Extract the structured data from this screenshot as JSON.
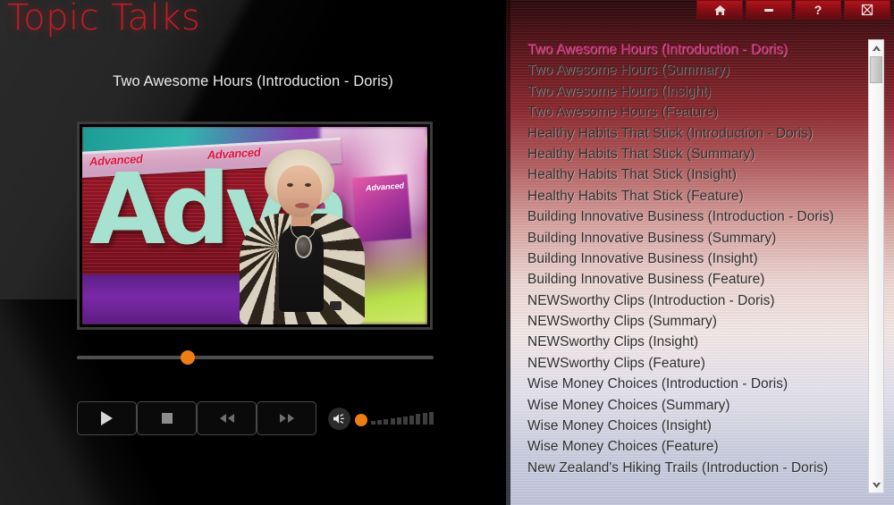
{
  "app": {
    "title": "Topic Talks"
  },
  "window_controls": [
    {
      "name": "home",
      "icon": "home-icon",
      "label": ""
    },
    {
      "name": "minimize",
      "icon": "minimize-icon",
      "label": ""
    },
    {
      "name": "help",
      "icon": "help-icon",
      "label": "?"
    },
    {
      "name": "close",
      "icon": "close-icon",
      "label": ""
    }
  ],
  "player": {
    "now_playing_title": "Two Awesome Hours (Introduction - Doris)",
    "seek_percent": 29,
    "volume_percent": 5,
    "video_still": {
      "banner_text_1": "Advanced",
      "banner_text_2": "Advanced",
      "big_word": "Adva",
      "card_text": "Advanced"
    },
    "controls": [
      {
        "name": "play",
        "label": "Play",
        "icon": "play-icon"
      },
      {
        "name": "stop",
        "label": "Stop",
        "icon": "stop-icon"
      },
      {
        "name": "rewind",
        "label": "Rewind",
        "icon": "rewind-icon"
      },
      {
        "name": "fast-forward",
        "label": "Fast Forward",
        "icon": "fast-forward-icon"
      }
    ],
    "volume_icon": "speaker-icon",
    "volume_bars": [
      4,
      5,
      6,
      7,
      8,
      9,
      10,
      12,
      13,
      14
    ]
  },
  "playlist": {
    "selected_index": 0,
    "items": [
      "Two Awesome Hours (Introduction - Doris)",
      "Two Awesome Hours (Summary)",
      "Two Awesome Hours (Insight)",
      "Two Awesome Hours (Feature)",
      "Healthy Habits That Stick (Introduction - Doris)",
      "Healthy Habits That Stick (Summary)",
      "Healthy Habits That Stick (Insight)",
      "Healthy Habits That Stick (Feature)",
      "Building Innovative Business (Introduction - Doris)",
      "Building Innovative Business (Summary)",
      "Building Innovative Business (Insight)",
      "Building Innovative Business (Feature)",
      "NEWSworthy Clips (Introduction - Doris)",
      "NEWSworthy Clips (Summary)",
      "NEWSworthy Clips (Insight)",
      "NEWSworthy Clips (Feature)",
      "Wise Money Choices (Introduction - Doris)",
      "Wise Money Choices (Summary)",
      "Wise Money Choices (Insight)",
      "Wise Money Choices (Feature)",
      "New Zealand's Hiking Trails (Introduction - Doris)"
    ],
    "scrollbar": {
      "up_arrow": "chevron-up-icon",
      "down_arrow": "chevron-down-icon"
    }
  },
  "colors": {
    "brand_red": "#c21d25",
    "accent_orange": "#f07d14",
    "selected_pink": "#cf1a7a",
    "panel_dark": "#000000"
  }
}
